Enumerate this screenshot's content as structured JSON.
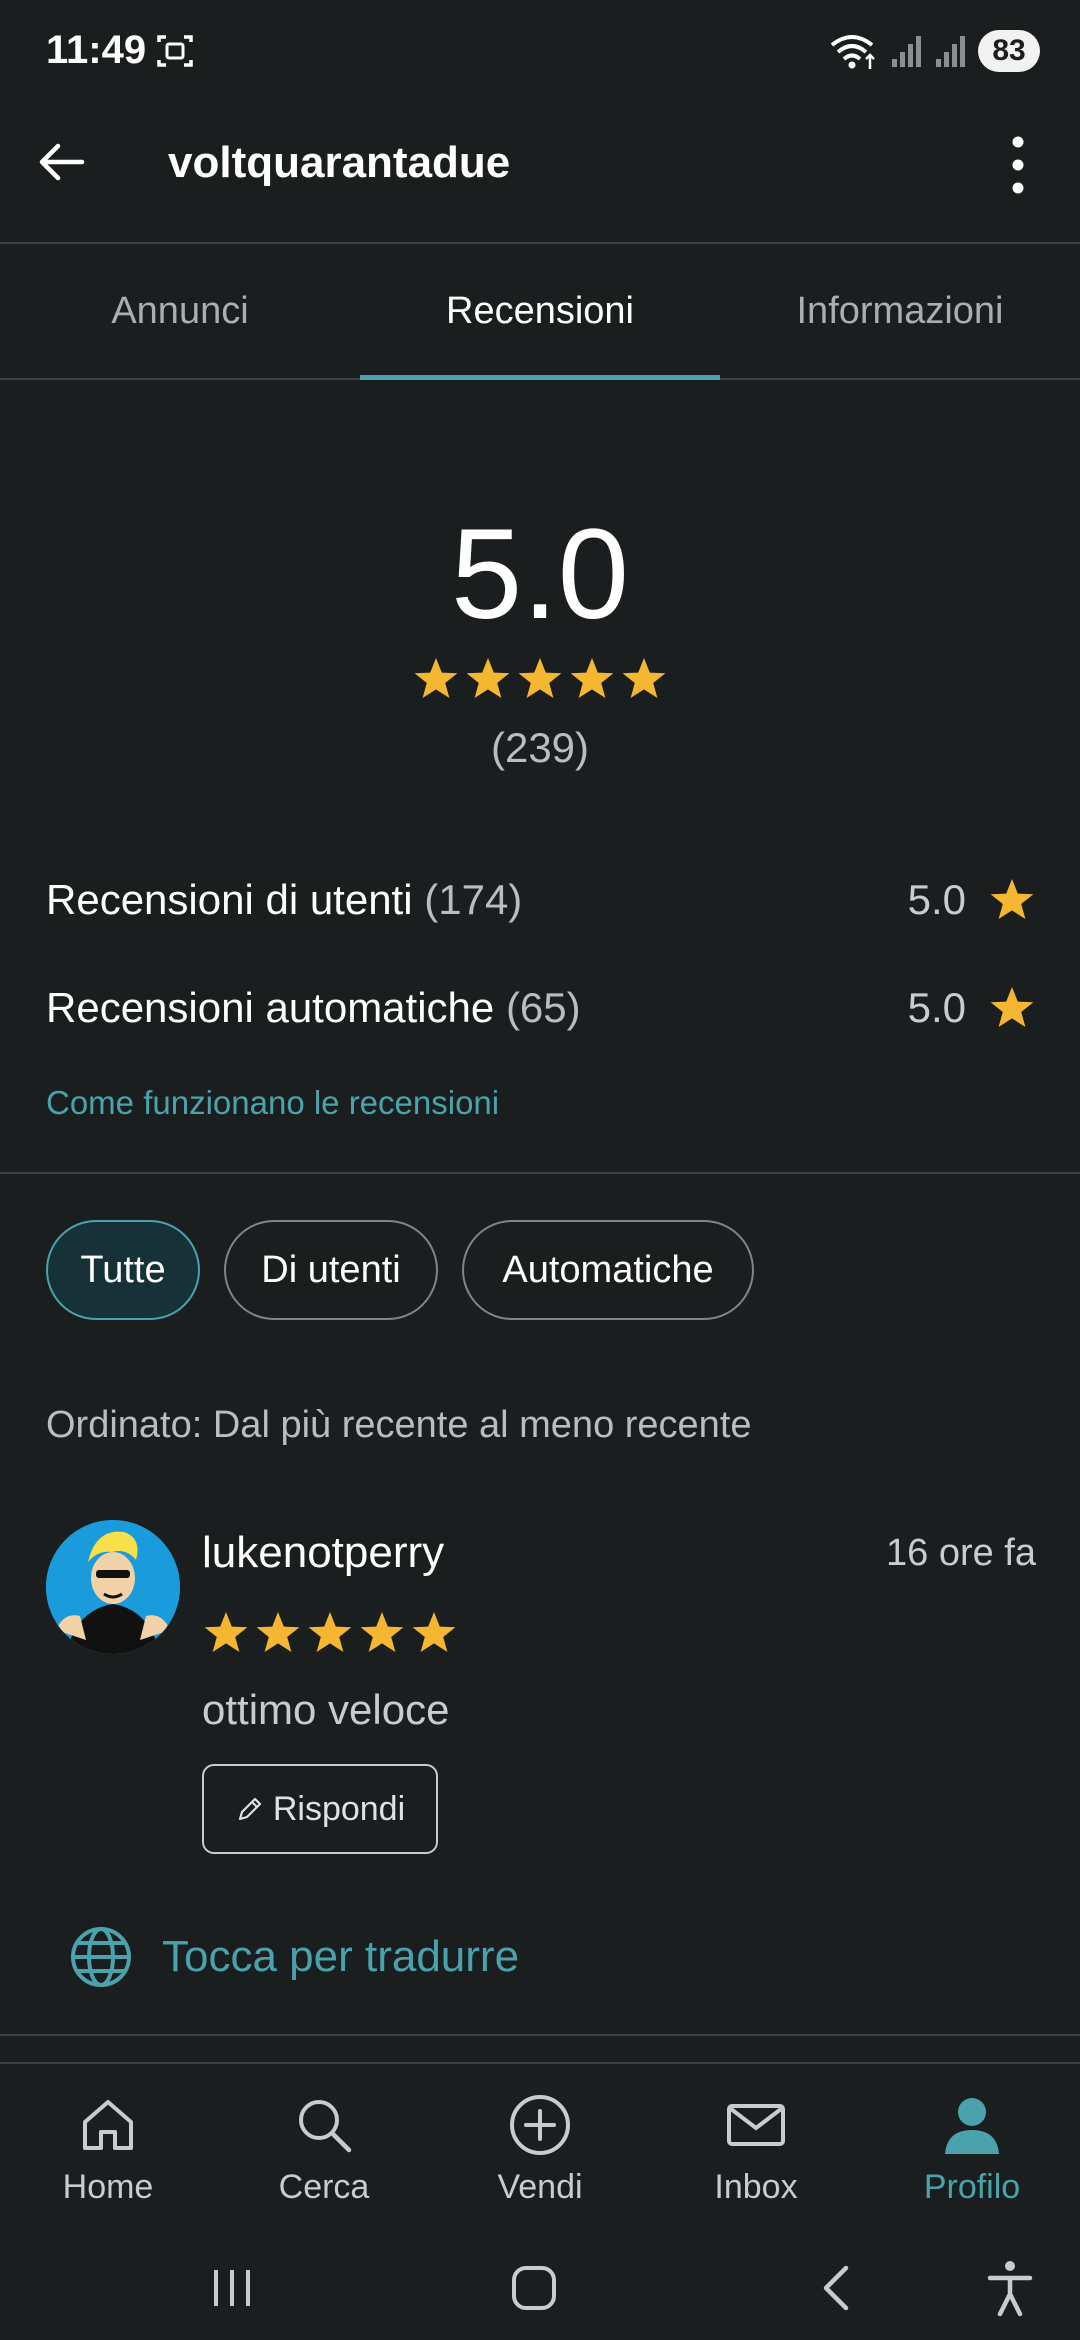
{
  "status_bar": {
    "time": "11:49",
    "battery": "83"
  },
  "app_bar": {
    "title": "voltquarantadue"
  },
  "tabs": [
    {
      "label": "Annunci",
      "active": false
    },
    {
      "label": "Recensioni",
      "active": true
    },
    {
      "label": "Informazioni",
      "active": false
    }
  ],
  "summary": {
    "score": "5.0",
    "stars": 5,
    "count": "(239)"
  },
  "breakdown": [
    {
      "label": "Recensioni di utenti",
      "count": "(174)",
      "score": "5.0"
    },
    {
      "label": "Recensioni automatiche",
      "count": "(65)",
      "score": "5.0"
    }
  ],
  "how_link": "Come funzionano le recensioni",
  "filters": [
    {
      "label": "Tutte",
      "active": true
    },
    {
      "label": "Di utenti",
      "active": false
    },
    {
      "label": "Automatiche",
      "active": false
    }
  ],
  "sort_label": "Ordinato: Dal più recente al meno recente",
  "review": {
    "username": "lukenotperry",
    "time": "16 ore fa",
    "stars": 5,
    "text": "ottimo veloce",
    "reply_label": "Rispondi"
  },
  "translate_label": "Tocca per tradurre",
  "bottom_nav": [
    {
      "label": "Home",
      "icon": "home-icon",
      "active": false
    },
    {
      "label": "Cerca",
      "icon": "search-icon",
      "active": false
    },
    {
      "label": "Vendi",
      "icon": "plus-circle-icon",
      "active": false
    },
    {
      "label": "Inbox",
      "icon": "mail-icon",
      "active": false
    },
    {
      "label": "Profilo",
      "icon": "profile-icon",
      "active": true
    }
  ],
  "colors": {
    "accent": "#4aa3ac",
    "star": "#f5b731",
    "background": "#1b1e1f"
  }
}
